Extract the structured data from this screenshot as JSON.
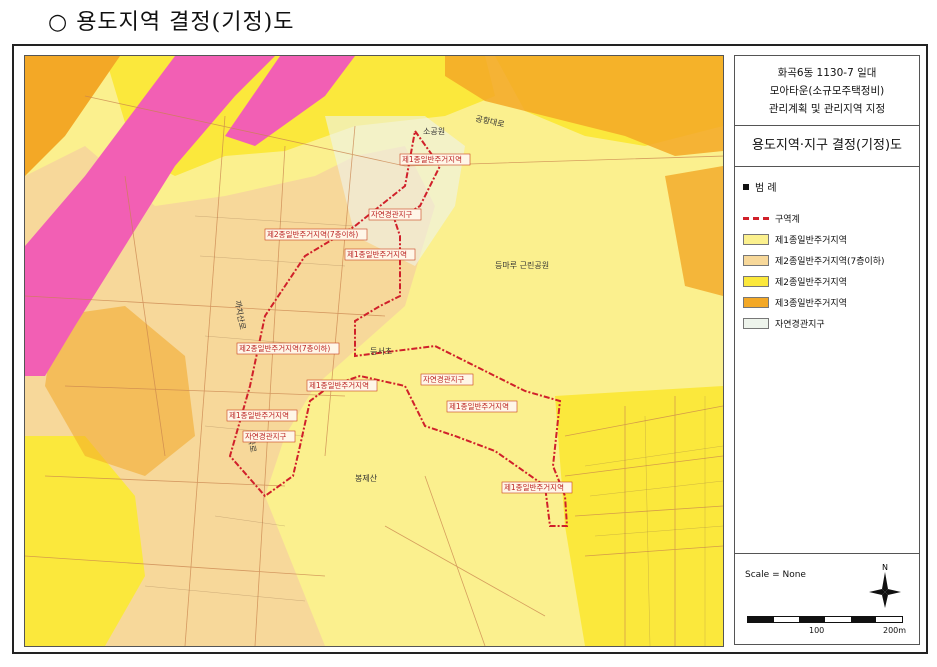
{
  "heading": "○ 용도지역 결정(기정)도",
  "panel": {
    "title_lines": [
      "화곡6동 1130-7 일대",
      "모아타운(소규모주택정비)",
      "관리계획 및 관리지역 지정"
    ],
    "subtitle": "용도지역·지구 결정(기정)도",
    "legend_title": "범   례",
    "legend": [
      {
        "label": "구역계",
        "type": "line",
        "color": "#d0202a"
      },
      {
        "label": "제1종일반주거지역",
        "type": "fill",
        "color": "#fbf08e"
      },
      {
        "label": "제2종일반주거지역(7층이하)",
        "type": "fill",
        "color": "#f7d89a"
      },
      {
        "label": "제2종일반주거지역",
        "type": "fill",
        "color": "#fbe83c"
      },
      {
        "label": "제3종일반주거지역",
        "type": "fill",
        "color": "#f3a826"
      },
      {
        "label": "자연경관지구",
        "type": "fill",
        "color": "#eef4ec"
      }
    ],
    "scale_text": "Scale = None",
    "north_label": "N",
    "scale_ticks": [
      "100",
      "200m"
    ]
  },
  "map": {
    "place_labels": [
      "소공원",
      "공항대로",
      "등마루 근린공원",
      "등서초",
      "봉제산",
      "까치산로",
      "화곡로"
    ],
    "zone_labels": [
      "제1종일반주거지역",
      "자연경관지구",
      "제2종일반주거지역(7층이하)",
      "제1종일반주거지역",
      "제2종일반주거지역(7층이하)",
      "제1종일반주거지역",
      "자연경관지구",
      "제1종일반주거지역",
      "제1종일반주거지역",
      "자연경관지구",
      "제1종일반주거지역"
    ]
  }
}
